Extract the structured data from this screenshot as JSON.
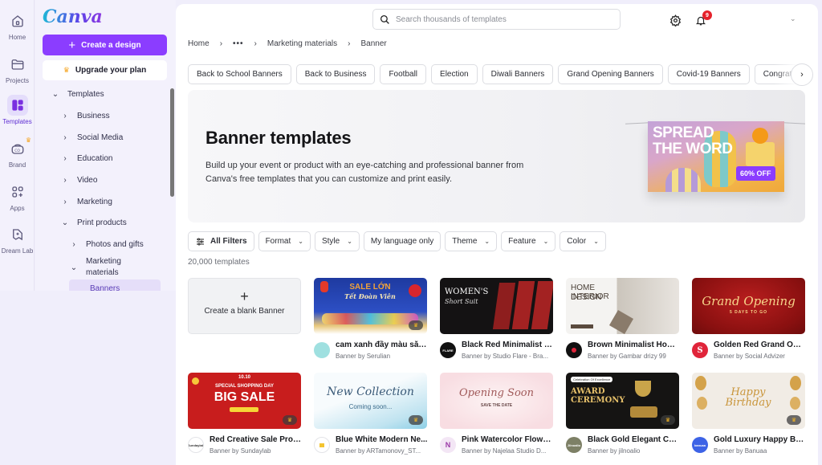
{
  "rail": {
    "items": [
      {
        "label": "Home",
        "icon": "home-icon"
      },
      {
        "label": "Projects",
        "icon": "folder-icon"
      },
      {
        "label": "Templates",
        "icon": "templates-icon",
        "active": true
      },
      {
        "label": "Brand",
        "icon": "brand-icon",
        "premium": true
      },
      {
        "label": "Apps",
        "icon": "apps-icon"
      },
      {
        "label": "Dream Lab",
        "icon": "dream-lab-icon"
      }
    ]
  },
  "sidebar": {
    "logo": "Canva",
    "create_label": "Create a design",
    "upgrade_label": "Upgrade your plan",
    "tree": [
      {
        "label": "Templates",
        "expanded": true,
        "level": 0
      },
      {
        "label": "Business",
        "expanded": false,
        "level": 1
      },
      {
        "label": "Social Media",
        "expanded": false,
        "level": 1
      },
      {
        "label": "Education",
        "expanded": false,
        "level": 1
      },
      {
        "label": "Video",
        "expanded": false,
        "level": 1
      },
      {
        "label": "Marketing",
        "expanded": false,
        "level": 1
      },
      {
        "label": "Print products",
        "expanded": true,
        "level": 1
      },
      {
        "label": "Photos and gifts",
        "expanded": false,
        "level": 2
      },
      {
        "label": "Marketing materials",
        "expanded": true,
        "level": 2
      },
      {
        "label": "Banners",
        "selected": true,
        "level": 3
      }
    ]
  },
  "topbar": {
    "search_placeholder": "Search thousands of templates",
    "notification_count": "9"
  },
  "breadcrumb": [
    "Home",
    "•••",
    "Marketing materials",
    "Banner"
  ],
  "chips": [
    "Back to School Banners",
    "Back to Business",
    "Football",
    "Election",
    "Diwali Banners",
    "Grand Opening Banners",
    "Covid-19 Banners",
    "Congratulat"
  ],
  "hero": {
    "title": "Banner templates",
    "description": "Build up your event or product with an eye-catching and professional banner from Canva's free templates that you can customize and print easily.",
    "art_text_line1": "SPREAD",
    "art_text_line2": "THE WORD",
    "art_badge": "60% OFF"
  },
  "filters": {
    "all_filters": "All Filters",
    "dropdowns": [
      "Format",
      "Style",
      "My language only",
      "Theme",
      "Feature",
      "Color"
    ]
  },
  "results_count": "20,000 templates",
  "blank_card": {
    "label": "Create a blank Banner"
  },
  "templates": [
    {
      "title": "cam xanh đầy màu sắc l...",
      "author": "Banner by Serulian",
      "premium": true,
      "thumb_text": "SALE LỚN",
      "thumb_sub": "Tết Đoàn Viên",
      "avatar_text": "",
      "avatar_color": "#9fe0e0"
    },
    {
      "title": "Black Red Minimalist Fa...",
      "author": "Banner by Studio Flare - Bra...",
      "premium": false,
      "thumb_text": "WOMEN'S",
      "thumb_sub": "Short Suit",
      "avatar_text": "FLARE",
      "avatar_color": "#111111"
    },
    {
      "title": "Brown Minimalist Hom...",
      "author": "Banner by Gambar drizy 99",
      "premium": false,
      "thumb_text": "HOME INTERIOR",
      "thumb_sub": "DESIGN",
      "avatar_text": "",
      "avatar_color": "#111111"
    },
    {
      "title": "Golden Red Grand Ope...",
      "author": "Banner by Social Advizer",
      "premium": false,
      "thumb_text": "Grand Opening",
      "thumb_sub": "5 DAYS TO GO",
      "avatar_text": "S",
      "avatar_color": "#e0243a"
    },
    {
      "title": "Red Creative Sale Prom...",
      "author": "Banner by Sundaylab",
      "premium": true,
      "thumb_text": "BIG SALE",
      "thumb_sub": "SPECIAL SHOPPING DAY",
      "avatar_text": "Sundaylab",
      "avatar_color": "#ffffff"
    },
    {
      "title": "Blue White Modern Ne...",
      "author": "Banner by ARTamonovy_ST...",
      "premium": true,
      "thumb_text": "New Collection",
      "thumb_sub": "Coming soon...",
      "avatar_text": "",
      "avatar_color": "#ffffff"
    },
    {
      "title": "Pink Watercolor Flower...",
      "author": "Banner by Najelaa Studio D...",
      "premium": false,
      "thumb_text": "Opening Soon",
      "thumb_sub": "SAVE THE DATE",
      "avatar_text": "N",
      "avatar_color": "#f3e6f5"
    },
    {
      "title": "Black Gold Elegant Co...",
      "author": "Banner by jilnoalio",
      "premium": true,
      "thumb_text": "AWARD CEREMONY",
      "thumb_sub": "Celebration Of Excellence",
      "avatar_text": "Jilnoalio",
      "avatar_color": "#7d8066"
    },
    {
      "title": "Gold Luxury Happy BIrt...",
      "author": "Banner by Banuaa",
      "premium": true,
      "thumb_text": "Happy Birthday",
      "thumb_sub": "",
      "avatar_text": "banuaa",
      "avatar_color": "#3d63e6"
    }
  ],
  "colors": {
    "accent": "#8b3dff",
    "badge": "#e5222b",
    "premium": "#f5a623"
  }
}
